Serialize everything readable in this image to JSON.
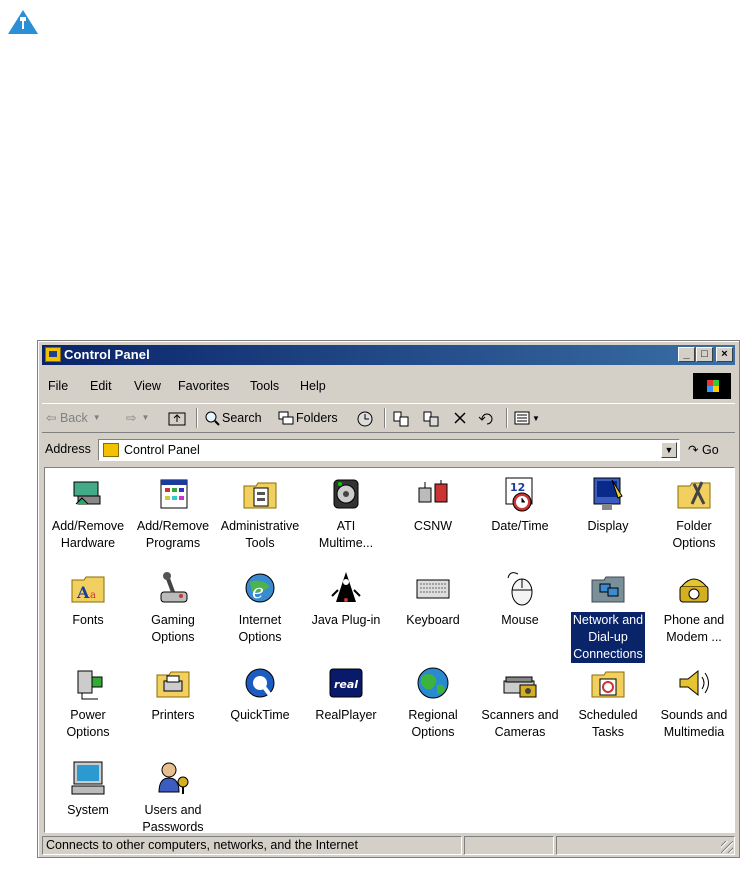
{
  "window": {
    "title": "Control Panel",
    "controls": [
      "_",
      "□",
      "×"
    ]
  },
  "menu": [
    "File",
    "Edit",
    "View",
    "Favorites",
    "Tools",
    "Help"
  ],
  "toolbar": {
    "back": "Back",
    "search": "Search",
    "folders": "Folders"
  },
  "address": {
    "label": "Address",
    "value": "Control Panel",
    "go": "Go"
  },
  "items": [
    {
      "label": "Add/Remove\nHardware",
      "icon": "add-remove-hardware-icon"
    },
    {
      "label": "Add/Remove\nPrograms",
      "icon": "add-remove-programs-icon"
    },
    {
      "label": "Administrative\nTools",
      "icon": "administrative-tools-icon"
    },
    {
      "label": "ATI\nMultime...",
      "icon": "ati-multimedia-icon"
    },
    {
      "label": "CSNW",
      "icon": "csnw-icon"
    },
    {
      "label": "Date/Time",
      "icon": "date-time-icon"
    },
    {
      "label": "Display",
      "icon": "display-icon"
    },
    {
      "label": "Folder\nOptions",
      "icon": "folder-options-icon"
    },
    {
      "label": "Fonts",
      "icon": "fonts-icon"
    },
    {
      "label": "Gaming\nOptions",
      "icon": "gaming-options-icon"
    },
    {
      "label": "Internet\nOptions",
      "icon": "internet-options-icon"
    },
    {
      "label": "Java Plug-in",
      "icon": "java-plugin-icon"
    },
    {
      "label": "Keyboard",
      "icon": "keyboard-icon"
    },
    {
      "label": "Mouse",
      "icon": "mouse-icon"
    },
    {
      "label": "Network and\nDial-up\nConnections",
      "icon": "network-connections-icon",
      "selected": true
    },
    {
      "label": "Phone and\nModem ...",
      "icon": "phone-modem-icon"
    },
    {
      "label": "Power\nOptions",
      "icon": "power-options-icon"
    },
    {
      "label": "Printers",
      "icon": "printers-icon"
    },
    {
      "label": "QuickTime",
      "icon": "quicktime-icon"
    },
    {
      "label": "RealPlayer",
      "icon": "realplayer-icon"
    },
    {
      "label": "Regional\nOptions",
      "icon": "regional-options-icon"
    },
    {
      "label": "Scanners and\nCameras",
      "icon": "scanners-cameras-icon"
    },
    {
      "label": "Scheduled\nTasks",
      "icon": "scheduled-tasks-icon"
    },
    {
      "label": "Sounds and\nMultimedia",
      "icon": "sounds-multimedia-icon"
    },
    {
      "label": "System",
      "icon": "system-icon"
    },
    {
      "label": "Users and\nPasswords",
      "icon": "users-passwords-icon"
    }
  ],
  "status": {
    "text": "Connects to other computers, networks, and the Internet"
  },
  "colors": {
    "title_start": "#0a246a",
    "title_end": "#3a6ea5",
    "selection": "#0a246a",
    "face": "#d4d0c8"
  }
}
